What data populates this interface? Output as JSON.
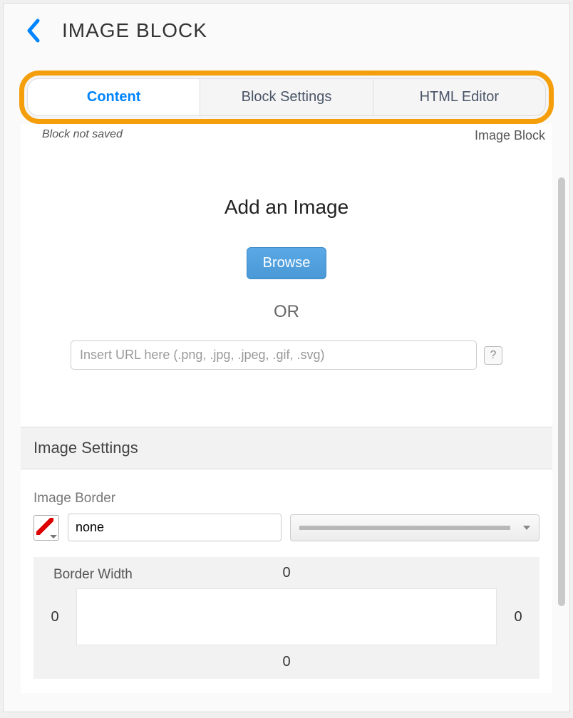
{
  "header": {
    "title": "IMAGE BLOCK"
  },
  "tabs": {
    "content": "Content",
    "block_settings": "Block Settings",
    "html_editor": "HTML Editor"
  },
  "status": {
    "not_saved": "Block not saved",
    "block_type": "Image Block"
  },
  "add_image": {
    "title": "Add an Image",
    "browse": "Browse",
    "or": "OR",
    "url_placeholder": "Insert URL here (.png, .jpg, .jpeg, .gif, .svg)",
    "help": "?"
  },
  "image_settings": {
    "section_title": "Image Settings",
    "border_label": "Image Border",
    "border_style_value": "none",
    "border_width_label": "Border Width",
    "border_width": {
      "top": "0",
      "right": "0",
      "bottom": "0",
      "left": "0"
    }
  }
}
